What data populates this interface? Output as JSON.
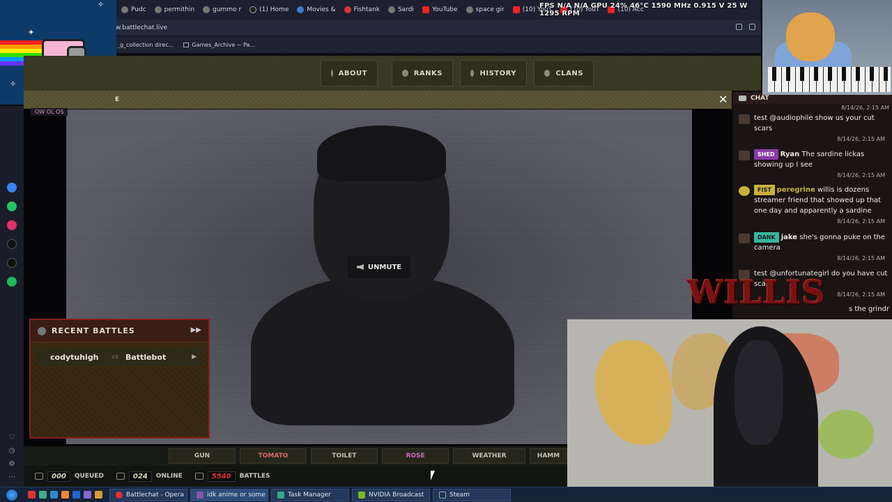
{
  "browser": {
    "tabs": [
      "Pudc",
      "permithin",
      "gummo r",
      "(1) Home",
      "Movies &",
      "Fishtank",
      "Sardi",
      "YouTube",
      "space gir",
      "(10) YouT",
      "(10) YouT",
      "(10) Acc"
    ],
    "url": "w.battlechat.live",
    "bookmarks": [
      "_g_collection direc...",
      "Games_Archive ~ Pa..."
    ]
  },
  "perf_overlay": "FPS N/A N/A GPU 24% 46°C 1590 MHz 0.915 V 25 W 1295 RPM",
  "site": {
    "nav": [
      "ABOUT",
      "RANKS",
      "HISTORY",
      "CLANS"
    ],
    "modal_title_fragment": "E",
    "video_tag": "OW OL OS",
    "unmute_label": "UNMUTE",
    "recent_battles": {
      "title": "RECENT BATTLES",
      "rows": [
        {
          "player1": "codytuhigh",
          "vs": "vs",
          "player2": "Battlebot"
        }
      ]
    },
    "items": [
      "GUN",
      "TOMATO",
      "TOILET",
      "ROSE",
      "WEATHER",
      "HAMM"
    ],
    "stats": {
      "queued_value": "000",
      "queued_label": "QUEUED",
      "online_value": "024",
      "online_label": "ONLINE",
      "battles_value": "5540",
      "battles_label": "BATTLES"
    }
  },
  "chat": {
    "title": "CHAT",
    "top_ts": "8/14/26, 2:15 AM",
    "messages": [
      {
        "badge": "",
        "user": "",
        "text": "test @audiophile show us your cut scars",
        "ts": "8/14/26, 2:15 AM"
      },
      {
        "badge": "SHED",
        "user": "Ryan",
        "text": "The sardine lickas showing up I see",
        "ts": "8/14/26, 2:15 AM"
      },
      {
        "badge": "FIST",
        "user": "peregrine",
        "text": "willis is dozens streamer friend that showed up that one day and apparently a sardine",
        "ts": "8/14/26, 2:15 AM"
      },
      {
        "badge": "DANK",
        "user": "jake",
        "text": "she's gonna puke on the camera",
        "ts": "8/14/26, 2:15 AM"
      },
      {
        "badge": "",
        "user": "",
        "text": "test @unfortunategirl do you have cut scars?",
        "ts": "8/14/26, 2:15 AM"
      },
      {
        "badge": "",
        "user": "",
        "text": "s the grindr",
        "ts": ""
      }
    ]
  },
  "overlay_text": "WILLIS",
  "taskbar": {
    "tasks": [
      "Battlechat - Opera",
      "idk anime or some s...",
      "Task Manager",
      "NVIDIA Broadcast",
      "Steam"
    ]
  },
  "colors": {
    "accent_red": "#8a1f1f",
    "olive": "#3a3a24",
    "taskbar": "#152238"
  }
}
